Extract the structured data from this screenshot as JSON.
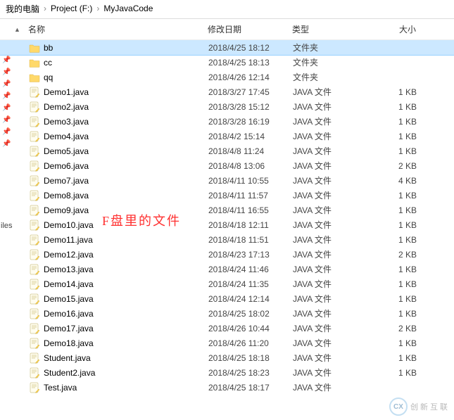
{
  "breadcrumb": {
    "part1": "我的电脑",
    "part2": "Project (F:)",
    "part3": "MyJavaCode",
    "sep": "›"
  },
  "columns": {
    "name": "名称",
    "date": "修改日期",
    "type": "类型",
    "size": "大小",
    "sort": "▲"
  },
  "types": {
    "folder": "文件夹",
    "java": "JAVA 文件"
  },
  "annotation": "F盘里的文件",
  "sidelabel": "iles",
  "watermark": {
    "logo": "CX",
    "text": "创新互联"
  },
  "files": [
    {
      "name": "bb",
      "date": "2018/4/25 18:12",
      "type": "folder",
      "size": "",
      "selected": true
    },
    {
      "name": "cc",
      "date": "2018/4/25 18:13",
      "type": "folder",
      "size": ""
    },
    {
      "name": "qq",
      "date": "2018/4/26 12:14",
      "type": "folder",
      "size": ""
    },
    {
      "name": "Demo1.java",
      "date": "2018/3/27 17:45",
      "type": "java",
      "size": "1 KB"
    },
    {
      "name": "Demo2.java",
      "date": "2018/3/28 15:12",
      "type": "java",
      "size": "1 KB"
    },
    {
      "name": "Demo3.java",
      "date": "2018/3/28 16:19",
      "type": "java",
      "size": "1 KB"
    },
    {
      "name": "Demo4.java",
      "date": "2018/4/2 15:14",
      "type": "java",
      "size": "1 KB"
    },
    {
      "name": "Demo5.java",
      "date": "2018/4/8 11:24",
      "type": "java",
      "size": "1 KB"
    },
    {
      "name": "Demo6.java",
      "date": "2018/4/8 13:06",
      "type": "java",
      "size": "2 KB"
    },
    {
      "name": "Demo7.java",
      "date": "2018/4/11 10:55",
      "type": "java",
      "size": "4 KB"
    },
    {
      "name": "Demo8.java",
      "date": "2018/4/11 11:57",
      "type": "java",
      "size": "1 KB"
    },
    {
      "name": "Demo9.java",
      "date": "2018/4/11 16:55",
      "type": "java",
      "size": "1 KB"
    },
    {
      "name": "Demo10.java",
      "date": "2018/4/18 12:11",
      "type": "java",
      "size": "1 KB"
    },
    {
      "name": "Demo11.java",
      "date": "2018/4/18 11:51",
      "type": "java",
      "size": "1 KB"
    },
    {
      "name": "Demo12.java",
      "date": "2018/4/23 17:13",
      "type": "java",
      "size": "2 KB"
    },
    {
      "name": "Demo13.java",
      "date": "2018/4/24 11:46",
      "type": "java",
      "size": "1 KB"
    },
    {
      "name": "Demo14.java",
      "date": "2018/4/24 11:35",
      "type": "java",
      "size": "1 KB"
    },
    {
      "name": "Demo15.java",
      "date": "2018/4/24 12:14",
      "type": "java",
      "size": "1 KB"
    },
    {
      "name": "Demo16.java",
      "date": "2018/4/25 18:02",
      "type": "java",
      "size": "1 KB"
    },
    {
      "name": "Demo17.java",
      "date": "2018/4/26 10:44",
      "type": "java",
      "size": "2 KB"
    },
    {
      "name": "Demo18.java",
      "date": "2018/4/26 11:20",
      "type": "java",
      "size": "1 KB"
    },
    {
      "name": "Student.java",
      "date": "2018/4/25 18:18",
      "type": "java",
      "size": "1 KB"
    },
    {
      "name": "Student2.java",
      "date": "2018/4/25 18:23",
      "type": "java",
      "size": "1 KB"
    },
    {
      "name": "Test.java",
      "date": "2018/4/25 18:17",
      "type": "java",
      "size": ""
    }
  ]
}
